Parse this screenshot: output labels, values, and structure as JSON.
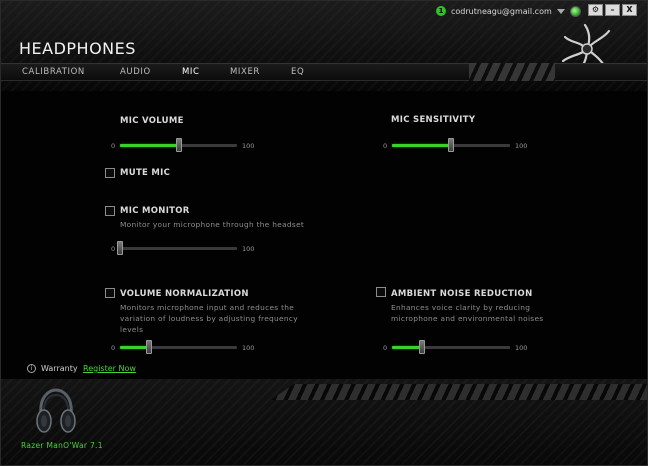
{
  "header": {
    "title": "HEADPHONES",
    "status_badge": "1",
    "account_email": "codrutneagu@gmail.com",
    "window_buttons": {
      "settings": "⚙",
      "minimize": "–",
      "close": "X"
    }
  },
  "tabs": [
    {
      "label": "CALIBRATION",
      "active": false
    },
    {
      "label": "AUDIO",
      "active": false
    },
    {
      "label": "MIC",
      "active": true
    },
    {
      "label": "MIXER",
      "active": false
    },
    {
      "label": "EQ",
      "active": false
    }
  ],
  "mic_volume": {
    "label": "MIC VOLUME",
    "min": "0",
    "max": "100",
    "value": 50
  },
  "mic_sensitivity": {
    "label": "MIC SENSITIVITY",
    "min": "0",
    "max": "100",
    "value": 50
  },
  "mute_mic": {
    "label": "MUTE MIC",
    "checked": false
  },
  "mic_monitor": {
    "label": "MIC MONITOR",
    "description": "Monitor your microphone through the headset",
    "min": "0",
    "max": "100",
    "value": 0,
    "checked": false
  },
  "volume_normalization": {
    "label": "VOLUME NORMALIZATION",
    "description": [
      "Monitors microphone input and reduces the",
      "variation of loudness by adjusting frequency",
      "levels"
    ],
    "min": "0",
    "max": "100",
    "value": 25,
    "checked": false
  },
  "ambient_noise_reduction": {
    "label": "AMBIENT NOISE REDUCTION",
    "description": [
      "Enhances voice clarity by reducing",
      "microphone and environmental noises"
    ],
    "min": "0",
    "max": "100",
    "value": 25,
    "checked": false
  },
  "footer": {
    "warranty_icon": "i",
    "warranty_label": "Warranty",
    "register_link": "Register Now",
    "device_name": "Razer ManO'War 7.1"
  },
  "colors": {
    "accent": "#3bd12b",
    "background": "#020202"
  },
  "icons": [
    "razer-logo-icon",
    "gear-icon",
    "minimize-icon",
    "close-icon",
    "chevron-down-icon",
    "sync-icon",
    "info-icon",
    "headset-icon"
  ]
}
